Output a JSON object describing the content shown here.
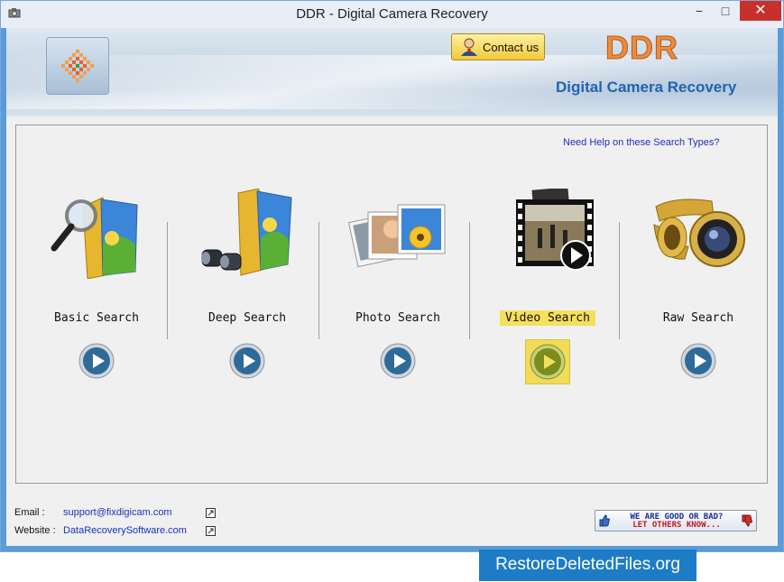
{
  "window": {
    "title": "DDR - Digital Camera Recovery",
    "minimize_glyph": "−",
    "maximize_glyph": "□",
    "close_glyph": "✕"
  },
  "header": {
    "contact_label": "Contact us",
    "brand_title": "DDR",
    "brand_subtitle": "Digital Camera Recovery"
  },
  "panel": {
    "help_link": "Need Help on these Search Types?",
    "search_types": [
      {
        "label": "Basic Search",
        "icon": "magnifier-folder-icon",
        "selected": false
      },
      {
        "label": "Deep Search",
        "icon": "binoculars-folder-icon",
        "selected": false
      },
      {
        "label": "Photo Search",
        "icon": "photos-icon",
        "selected": false
      },
      {
        "label": "Video Search",
        "icon": "video-film-icon",
        "selected": true
      },
      {
        "label": "Raw Search",
        "icon": "camera-lens-film-icon",
        "selected": false
      }
    ]
  },
  "footer": {
    "email_label": "Email :",
    "email_value": "support@fixdigicam.com",
    "website_label": "Website :",
    "website_value": "DataRecoverySoftware.com",
    "rate_line1": "WE ARE GOOD OR BAD?",
    "rate_line2": "LET OTHERS KNOW..."
  },
  "watermark": "RestoreDeletedFiles.org",
  "colors": {
    "accent_yellow": "#f3dc55",
    "brand_orange": "#ef8a3c",
    "brand_blue": "#2463b0",
    "link_blue": "#1b2fbf",
    "close_red": "#c7312b"
  }
}
